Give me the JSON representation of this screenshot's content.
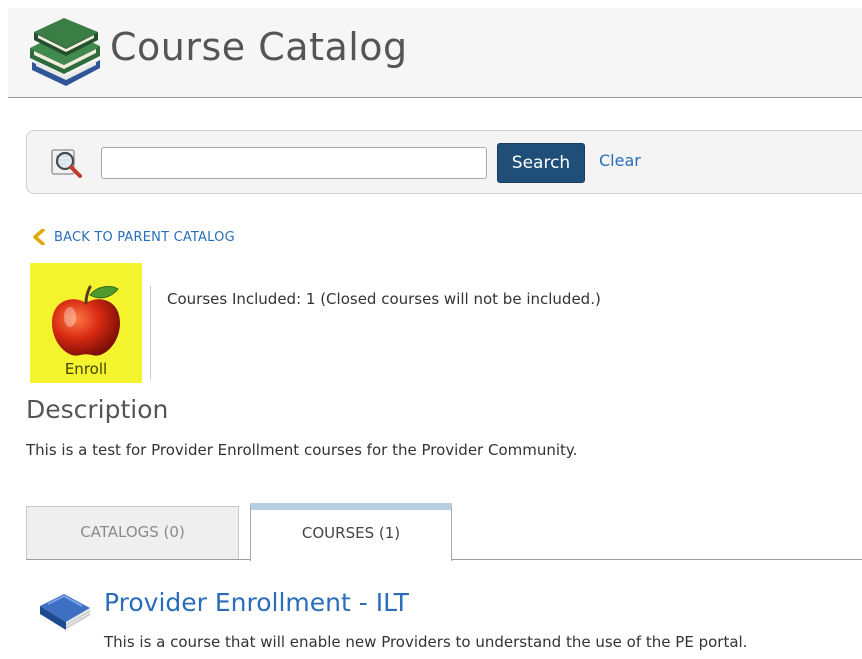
{
  "header": {
    "title": "Course Catalog",
    "icon": "books-stack-icon"
  },
  "search": {
    "icon": "magnifier-icon",
    "value": "",
    "placeholder": "",
    "button_label": "Search",
    "clear_label": "Clear"
  },
  "back": {
    "label": "BACK TO PARENT CATALOG",
    "icon": "chevron-left-icon"
  },
  "catalog_tile": {
    "label": "Enroll",
    "icon": "apple-icon",
    "background": "#f3f32e"
  },
  "courses_included": "Courses Included: 1 (Closed courses will not be included.)",
  "description": {
    "heading": "Description",
    "text": "This is a test for Provider Enrollment courses for the Provider Community."
  },
  "tabs": [
    {
      "label": "CATALOGS (0)",
      "active": false
    },
    {
      "label": "COURSES (1)",
      "active": true
    }
  ],
  "courses": [
    {
      "title": "Provider Enrollment - ILT",
      "description": "This is a course that will enable new Providers to understand the use of the PE portal.",
      "icon": "book-icon"
    }
  ],
  "colors": {
    "link": "#2a6ebb",
    "button": "#1f4e79",
    "active_tab_accent": "#b7cfe0",
    "back_chevron": "#e0a800"
  }
}
